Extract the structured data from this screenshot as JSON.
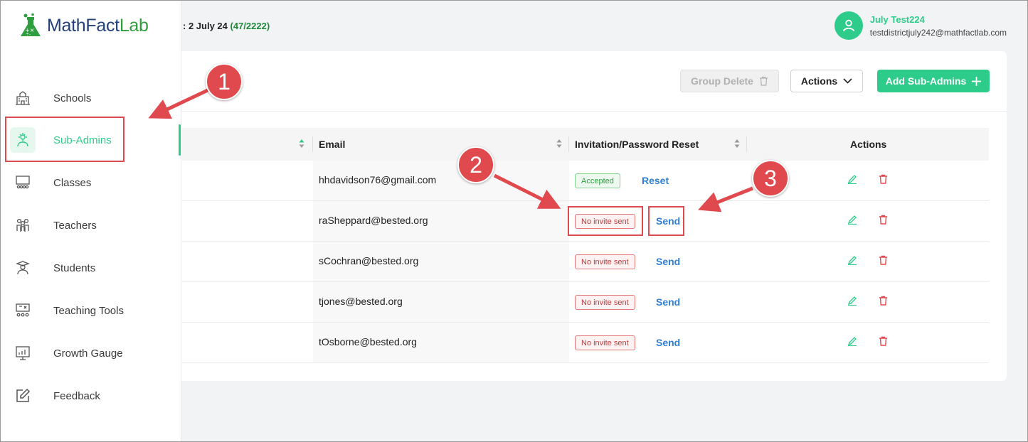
{
  "header": {
    "term_text": ": 2 July 24",
    "term_count": "(47/2222)"
  },
  "user": {
    "name": "July Test224",
    "email": "testdistrictjuly242@mathfactlab.com"
  },
  "brand": {
    "name_main": "MathFact",
    "name_accent": "Lab"
  },
  "sidebar": {
    "items": [
      {
        "label": "Schools",
        "icon": "school-icon"
      },
      {
        "label": "Sub-Admins",
        "icon": "sub-admin-icon",
        "active": true
      },
      {
        "label": "Classes",
        "icon": "classroom-icon"
      },
      {
        "label": "Teachers",
        "icon": "teachers-icon"
      },
      {
        "label": "Students",
        "icon": "student-icon"
      },
      {
        "label": "Teaching Tools",
        "icon": "teaching-tools-icon"
      },
      {
        "label": "Growth Gauge",
        "icon": "growth-chart-icon"
      },
      {
        "label": "Feedback",
        "icon": "feedback-edit-icon"
      }
    ]
  },
  "toolbar": {
    "group_delete_label": "Group Delete",
    "actions_label": "Actions",
    "add_label": "Add Sub-Admins"
  },
  "table": {
    "columns": [
      "Email",
      "Invitation/Password Reset",
      "Actions"
    ],
    "rows": [
      {
        "email": "hhdavidson76@gmail.com",
        "status": "Accepted",
        "action": "Reset"
      },
      {
        "email": "raSheppard@bested.org",
        "status": "No invite sent",
        "action": "Send"
      },
      {
        "email": "sCochran@bested.org",
        "status": "No invite sent",
        "action": "Send"
      },
      {
        "email": "tjones@bested.org",
        "status": "No invite sent",
        "action": "Send"
      },
      {
        "email": "tOsborne@bested.org",
        "status": "No invite sent",
        "action": "Send"
      }
    ]
  },
  "annotations": [
    "1",
    "2",
    "3"
  ],
  "colors": {
    "accent": "#2ecc8a",
    "link": "#2f7fd4",
    "danger": "#e0494d",
    "brand_blue": "#24407a",
    "brand_green": "#2e9e3e"
  }
}
